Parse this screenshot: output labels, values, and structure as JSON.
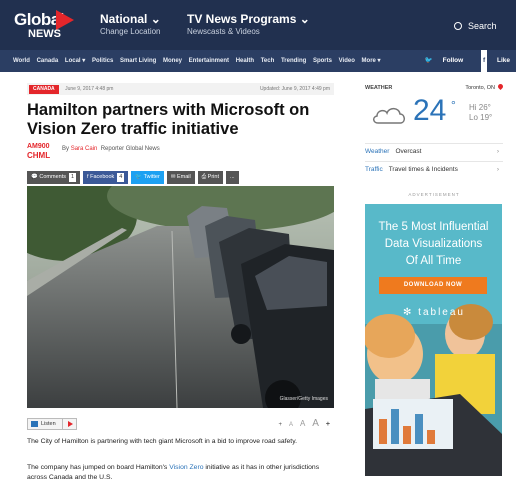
{
  "header": {
    "logo_top": "Global",
    "logo_bottom": "NEWS",
    "national_title": "National",
    "national_sub": "Change Location",
    "tv_title": "TV News Programs",
    "tv_sub": "Newscasts & Videos",
    "search_label": "Search",
    "caret": "⌄"
  },
  "nav": {
    "items": [
      "World",
      "Canada",
      "Local ▾",
      "Politics",
      "Smart Living",
      "Money",
      "Entertainment",
      "Health",
      "Tech",
      "Trending",
      "Sports",
      "Video",
      "More ▾"
    ],
    "follow_label": "Follow",
    "like_label": "Like"
  },
  "article": {
    "category": "CANADA",
    "published": "June 9, 2017 4:48 pm",
    "updated": "Updated: June 9, 2017 4:49 pm",
    "headline": "Hamilton partners with Microsoft on Vision Zero traffic initiative",
    "source_logo_top": "AM900",
    "source_logo_bottom": "CHML",
    "by": "By",
    "author": "Sara Cain",
    "author_role": "Reporter  Global News",
    "share": {
      "comments_label": "Comments",
      "comments_count": "1",
      "facebook_label": "Facebook",
      "facebook_count": "4",
      "twitter_label": "Twitter",
      "email_label": "Email",
      "print_label": "Print",
      "more_label": "..."
    },
    "image_credit": "Glasser/Getty Images",
    "listen_label": "Listen",
    "font_controls": [
      "+",
      "A",
      "A",
      "A",
      "+"
    ],
    "para1": "The City of Hamilton is partnering with tech giant Microsoft in a bid to improve road safety.",
    "para2_pre": "The company has jumped on board Hamilton's ",
    "para2_link": "Vision Zero",
    "para2_post": " initiative as it has in other jurisdictions across Canada and the U.S."
  },
  "weather": {
    "label": "WEATHER",
    "location": "Toronto, ON",
    "temp": "24",
    "deg": "°",
    "high": "Hi 26°",
    "low": "Lo 19°",
    "weather_key": "Weather",
    "weather_value": "Overcast",
    "traffic_key": "Traffic",
    "traffic_value": "Travel times & Incidents",
    "chevron": "›",
    "cloud_icon": "cloud-icon"
  },
  "ad": {
    "label": "ADVERTISEMENT",
    "line1": "The 5 Most Influential",
    "line2": "Data Visualizations",
    "line3": "Of All Time",
    "cta": "DOWNLOAD NOW",
    "brand": "tableau"
  },
  "colors": {
    "header_bg": "#21304f",
    "nav_bg": "#2b3e63",
    "accent_red": "#e4262b",
    "link_blue": "#2b73b8",
    "ad_bg": "#4fb3c6",
    "ad_cta": "#ef7a1e"
  }
}
